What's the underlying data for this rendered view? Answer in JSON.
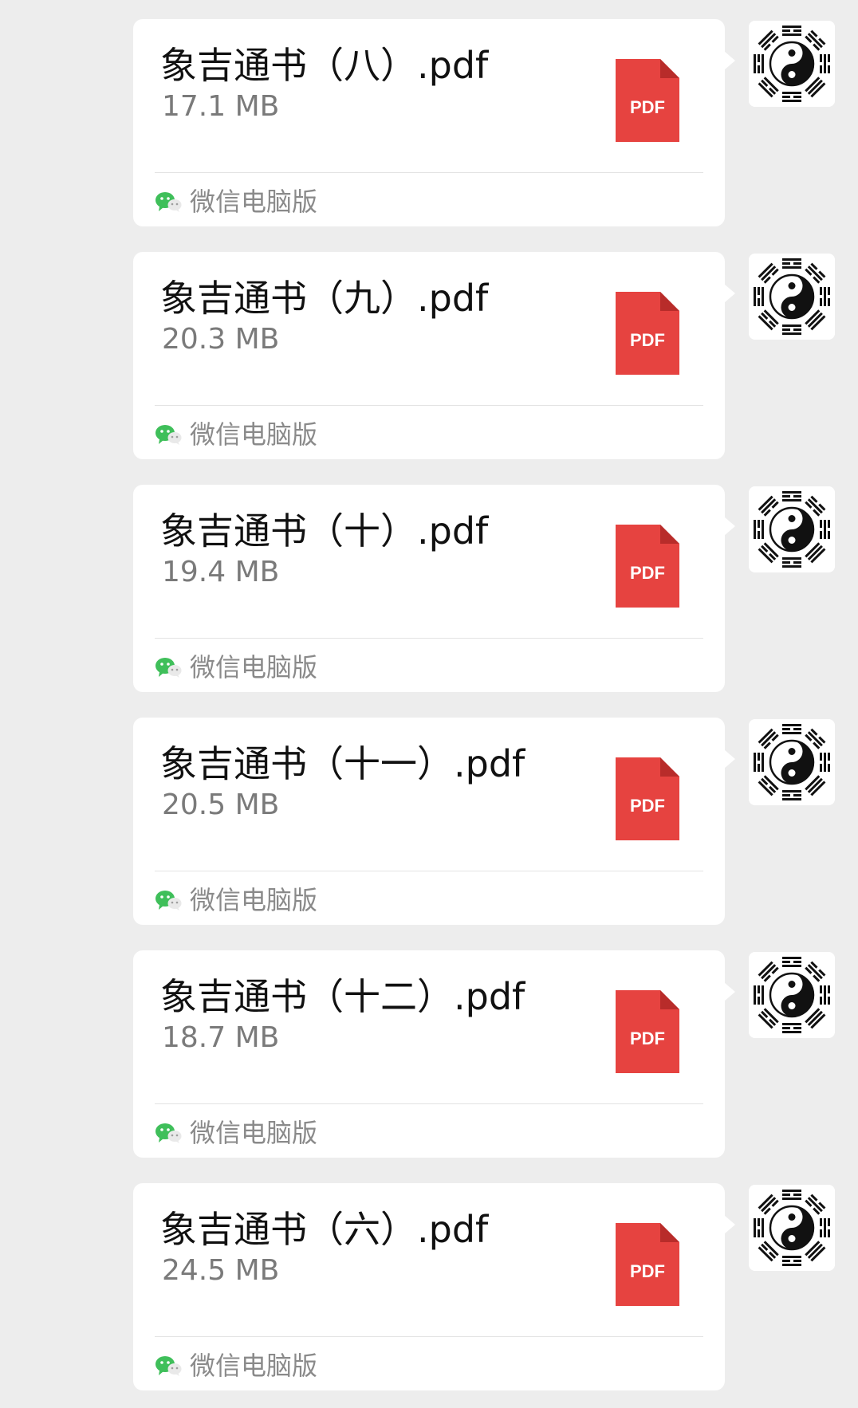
{
  "messages": [
    {
      "file_name": "象吉通书（八）.pdf",
      "file_size": "17.1 MB",
      "file_type": "PDF",
      "source": "微信电脑版",
      "avatar_icon": "bagua-yinyang-icon"
    },
    {
      "file_name": "象吉通书（九）.pdf",
      "file_size": "20.3 MB",
      "file_type": "PDF",
      "source": "微信电脑版",
      "avatar_icon": "bagua-yinyang-icon"
    },
    {
      "file_name": "象吉通书（十）.pdf",
      "file_size": "19.4 MB",
      "file_type": "PDF",
      "source": "微信电脑版",
      "avatar_icon": "bagua-yinyang-icon"
    },
    {
      "file_name": "象吉通书（十一）.pdf",
      "file_size": "20.5 MB",
      "file_type": "PDF",
      "source": "微信电脑版",
      "avatar_icon": "bagua-yinyang-icon"
    },
    {
      "file_name": "象吉通书（十二）.pdf",
      "file_size": "18.7 MB",
      "file_type": "PDF",
      "source": "微信电脑版",
      "avatar_icon": "bagua-yinyang-icon"
    },
    {
      "file_name": "象吉通书（六）.pdf",
      "file_size": "24.5 MB",
      "file_type": "PDF",
      "source": "微信电脑版",
      "avatar_icon": "bagua-yinyang-icon"
    }
  ],
  "colors": {
    "background": "#ededed",
    "bubble": "#ffffff",
    "pdf_red": "#e64340",
    "wechat_green": "#3fbf5a"
  }
}
